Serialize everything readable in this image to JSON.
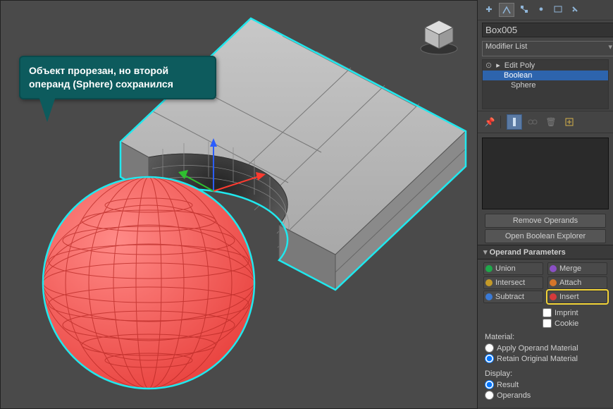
{
  "callout": "Объект прорезан, но второй операнд (Sphere) сохранился",
  "object_name": "Box005",
  "modifier_dropdown": "Modifier List",
  "stack": {
    "top": "Edit Poly",
    "items": [
      "Boolean",
      "Sphere"
    ]
  },
  "buttons": {
    "remove": "Remove Operands",
    "explorer": "Open Boolean Explorer"
  },
  "rollout": "Operand Parameters",
  "ops": {
    "union": "Union",
    "merge": "Merge",
    "intersect": "Intersect",
    "attach": "Attach",
    "subtract": "Subtract",
    "insert": "Insert"
  },
  "checks": {
    "imprint": "Imprint",
    "cookie": "Cookie"
  },
  "material": {
    "label": "Material:",
    "apply": "Apply Operand Material",
    "retain": "Retain Original Material"
  },
  "display": {
    "label": "Display:",
    "result": "Result",
    "operands": "Operands"
  }
}
